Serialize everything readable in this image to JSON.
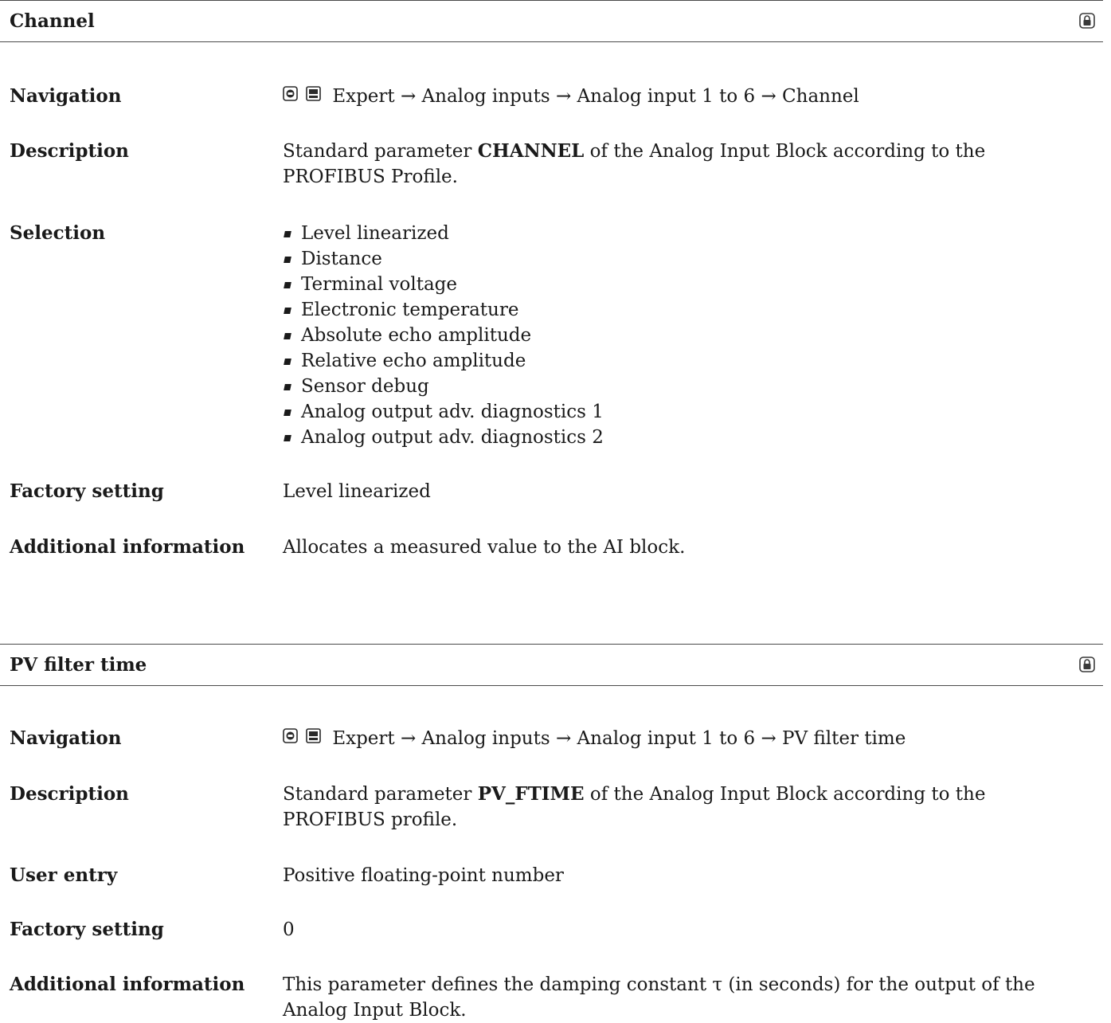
{
  "sections": [
    {
      "title": "Channel",
      "navigation": {
        "label": "Navigation",
        "path": "Expert → Analog inputs → Analog input 1 to 6 → Channel"
      },
      "description": {
        "label": "Description",
        "prefix": "Standard parameter ",
        "bold": "CHANNEL",
        "suffix": " of the Analog Input Block according to the PROFIBUS Profile."
      },
      "selection": {
        "label": "Selection",
        "options": [
          "Level linearized",
          "Distance",
          "Terminal voltage",
          "Electronic temperature",
          "Absolute echo amplitude",
          "Relative echo amplitude",
          "Sensor debug",
          "Analog output adv. diagnostics 1",
          "Analog output adv. diagnostics 2"
        ]
      },
      "factory_setting": {
        "label": "Factory setting",
        "value": "Level linearized"
      },
      "additional_information": {
        "label": "Additional information",
        "value": "Allocates a measured value to the AI block."
      }
    },
    {
      "title": "PV filter time",
      "navigation": {
        "label": "Navigation",
        "path": "Expert → Analog inputs → Analog input 1 to 6 → PV filter time"
      },
      "description": {
        "label": "Description",
        "prefix": "Standard parameter ",
        "bold": "PV_FTIME",
        "suffix": " of the Analog Input Block according to the PROFIBUS profile."
      },
      "user_entry": {
        "label": "User entry",
        "value": "Positive floating-point number"
      },
      "factory_setting": {
        "label": "Factory setting",
        "value": "0"
      },
      "additional_information": {
        "label": "Additional information",
        "value": "This parameter defines the damping constant τ (in seconds) for the output of the Analog Input Block."
      }
    }
  ],
  "icons": {
    "header_icon": "lock-icon",
    "navigation_icons": [
      "onsite-display-icon",
      "operating-tool-icon"
    ]
  }
}
